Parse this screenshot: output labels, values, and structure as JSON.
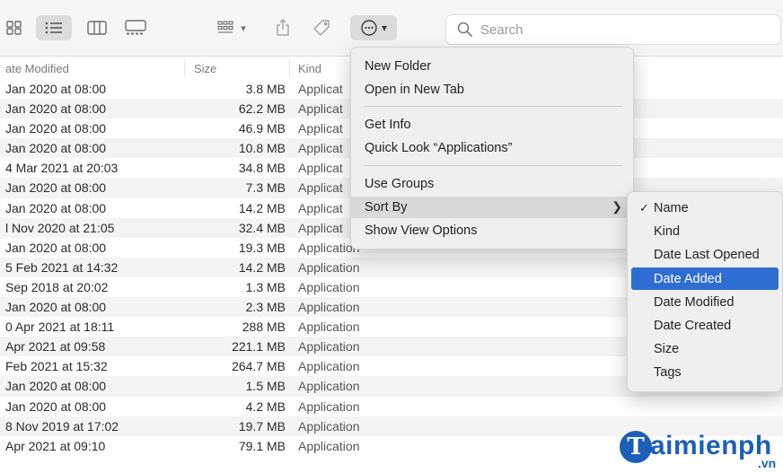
{
  "toolbar": {
    "icons": [
      "icon-view-icon",
      "list-view-icon",
      "column-view-icon",
      "gallery-view-icon",
      "group-menu-icon",
      "share-icon",
      "tag-icon",
      "action-menu-icon"
    ],
    "search_placeholder": "Search"
  },
  "columns": {
    "date_modified": "ate Modified",
    "size": "Size",
    "kind": "Kind"
  },
  "rows": [
    {
      "date": "Jan 2020 at 08:00",
      "size": "3.8 MB",
      "kind": "Applicat"
    },
    {
      "date": "Jan 2020 at 08:00",
      "size": "62.2 MB",
      "kind": "Applicat"
    },
    {
      "date": "Jan 2020 at 08:00",
      "size": "46.9 MB",
      "kind": "Applicat"
    },
    {
      "date": "Jan 2020 at 08:00",
      "size": "10.8 MB",
      "kind": "Applicat"
    },
    {
      "date": "4 Mar 2021 at 20:03",
      "size": "34.8 MB",
      "kind": "Applicat"
    },
    {
      "date": "Jan 2020 at 08:00",
      "size": "7.3 MB",
      "kind": "Applicat"
    },
    {
      "date": "Jan 2020 at 08:00",
      "size": "14.2 MB",
      "kind": "Applicat"
    },
    {
      "date": "l Nov 2020 at 21:05",
      "size": "32.4 MB",
      "kind": "Applicat"
    },
    {
      "date": "Jan 2020 at 08:00",
      "size": "19.3 MB",
      "kind": "Application"
    },
    {
      "date": "5 Feb 2021 at 14:32",
      "size": "14.2 MB",
      "kind": "Application"
    },
    {
      "date": "Sep 2018 at 20:02",
      "size": "1.3 MB",
      "kind": "Application"
    },
    {
      "date": "Jan 2020 at 08:00",
      "size": "2.3 MB",
      "kind": "Application"
    },
    {
      "date": "0 Apr 2021 at 18:11",
      "size": "288 MB",
      "kind": "Application"
    },
    {
      "date": "Apr 2021 at 09:58",
      "size": "221.1 MB",
      "kind": "Application"
    },
    {
      "date": "Feb 2021 at 15:32",
      "size": "264.7 MB",
      "kind": "Application"
    },
    {
      "date": "Jan 2020 at 08:00",
      "size": "1.5 MB",
      "kind": "Application"
    },
    {
      "date": "Jan 2020 at 08:00",
      "size": "4.2 MB",
      "kind": "Application"
    },
    {
      "date": "8 Nov 2019 at 17:02",
      "size": "19.7 MB",
      "kind": "Application"
    },
    {
      "date": "Apr 2021 at 09:10",
      "size": "79.1 MB",
      "kind": "Application"
    }
  ],
  "menu": {
    "new_folder": "New Folder",
    "open_in_new_tab": "Open in New Tab",
    "get_info": "Get Info",
    "quick_look": "Quick Look “Applications”",
    "use_groups": "Use Groups",
    "sort_by": "Sort By",
    "show_view_options": "Show View Options"
  },
  "submenu": {
    "checkmark": "✓",
    "items": [
      "Name",
      "Kind",
      "Date Last Opened",
      "Date Added",
      "Date Modified",
      "Date Created",
      "Size",
      "Tags"
    ],
    "checked": "Name",
    "selected": "Date Added"
  },
  "watermark": {
    "brand": "aimienph",
    "tld": ".vn",
    "logo_letter": "T"
  },
  "colors": {
    "accent": "#2e6ed3",
    "watermark": "#1c5fb7"
  }
}
